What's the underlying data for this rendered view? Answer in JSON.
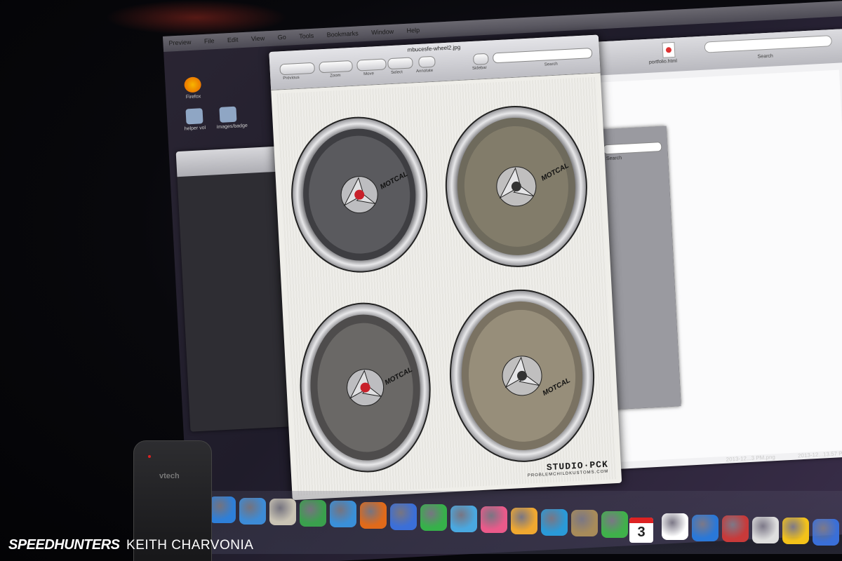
{
  "menubar": {
    "items": [
      "Preview",
      "File",
      "Edit",
      "View",
      "Go",
      "Tools",
      "Bookmarks",
      "Window",
      "Help"
    ]
  },
  "desktop": {
    "icons": [
      {
        "label": "Firefox",
        "color": "#e66000"
      },
      {
        "label": "helper vol",
        "color": "#8fa6c4"
      },
      {
        "label": "images/badge",
        "color": "#8fa6c4"
      }
    ]
  },
  "back_window": {
    "file_label": "portfolio.html",
    "search_label": "Search"
  },
  "mid_window": {
    "search_label": "Search"
  },
  "preview": {
    "title": "mbucesfe-wheel2.jpg",
    "toolbar": [
      {
        "label": "Previous",
        "name": "previous-next-button"
      },
      {
        "label": "Zoom",
        "name": "zoom-button"
      },
      {
        "label": "Move",
        "name": "move-button"
      },
      {
        "label": "Select",
        "name": "select-button"
      },
      {
        "label": "Annotate",
        "name": "annotate-button"
      },
      {
        "label": "Sidebar",
        "name": "sidebar-button"
      }
    ],
    "search_label": "Search",
    "wheel_labels": [
      "MOTCAL",
      "MOTCAL",
      "MOTCAL",
      "MOTCAL"
    ],
    "watermark": {
      "brand": "STUDIO·PCK",
      "url": "PROBLEMCHILDKUSTOMS.COM"
    }
  },
  "timestamps": [
    "2013-12...3 PM.png",
    "2013-12...13.57 PM"
  ],
  "dock": {
    "calendar_day": "3",
    "icon_colors": [
      "#2e7fd8",
      "#3d8bd6",
      "#c9c3b4",
      "#3aa04d",
      "#3a8fd8",
      "#e06a1a",
      "#3b6fd8",
      "#36b14a",
      "#4aa8e0",
      "#ea5a8a",
      "#f0a830",
      "#2a9ad8",
      "#a78b5a",
      "#3fb14a",
      "#8d8d96",
      "#ffffff",
      "#2a78d8",
      "#c83a3a",
      "#dedede",
      "#f3c21a",
      "#3a6fd8"
    ]
  },
  "phone": {
    "brand": "vtech"
  },
  "credit": {
    "site": "SPEEDHUNTERS",
    "photographer": "KEITH CHARVONIA"
  }
}
